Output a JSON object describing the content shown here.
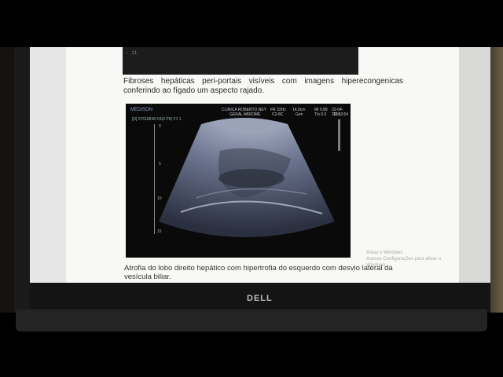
{
  "top_image": {
    "marker": "- 11"
  },
  "caption1": "Fibroses hepáticas peri-portais visíveis com imagens hiperecongenicas conferindo ao fígado um aspecto rajado.",
  "ultrasound": {
    "brand": "MEDISON",
    "patient_id": "[D] 07618848 FA(6 P8) F1 1",
    "clinic_line1": "CLINICA ROBERTO NEY",
    "clinic_line2": "GERAL ABDOME",
    "fr": "FR 33Hz",
    "probe": "C2-8C",
    "depth": "14.0cm",
    "gen": "Gen",
    "mi": "MI 0.89",
    "tis": "TIs 0.3",
    "date": "22-04-2016",
    "time": "11:13:54",
    "ticks": [
      "0",
      "5",
      "10",
      "15"
    ]
  },
  "caption2": "Atrofia do lobo direito hepático com hipertrofia do esquerdo com desvio lateral da vesícula biliar.",
  "watermark": [
    "Ativar o Windows",
    "Acesse Configurações para ativar o Windows."
  ],
  "laptop_logo": "DELL"
}
